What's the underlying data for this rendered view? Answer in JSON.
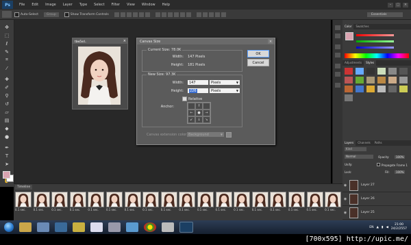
{
  "app": {
    "logo": "Ps",
    "menu": [
      "File",
      "Edit",
      "Image",
      "Layer",
      "Type",
      "Select",
      "Filter",
      "View",
      "Window",
      "Help"
    ]
  },
  "options_bar": {
    "auto_select_label": "Auto-Select",
    "auto_select_target": "Group",
    "show_transform_label": "Show Transform Controls",
    "workspace": "Essentials"
  },
  "document": {
    "title": "tbw5xd.."
  },
  "dialog": {
    "title": "Canvas Size",
    "current_size_label": "Current Size: 78.0K",
    "current_width_label": "Width:",
    "current_width_value": "147 Pixels",
    "current_height_label": "Height:",
    "current_height_value": "181 Pixels",
    "new_size_label": "New Size: 97.3K",
    "width_label": "Width:",
    "width_value": "147",
    "width_unit": "Pixels",
    "height_label": "Height:",
    "height_value": "226",
    "height_unit": "Pixels",
    "relative_label": "Relative",
    "anchor_label": "Anchor:",
    "extension_label": "Canvas extension color:",
    "extension_value": "Background",
    "ok_label": "OK",
    "cancel_label": "Cancel"
  },
  "right_panel": {
    "color_tabs": [
      "Color",
      "Swatches"
    ],
    "adj_tabs": [
      "Adjustments",
      "Styles"
    ],
    "layers_tabs": [
      "Layers",
      "Channels",
      "Paths"
    ],
    "kind_label": "Kind",
    "blend_mode": "Normal",
    "opacity_label": "Opacity:",
    "opacity_value": "100%",
    "unify_label": "Unify:",
    "propagate_label": "Propagate Frame 1",
    "lock_label": "Lock:",
    "fill_label": "Fill:",
    "fill_value": "100%",
    "layers": [
      "Layer 27",
      "Layer 26",
      "Layer 25"
    ]
  },
  "timeline": {
    "title": "Timeline",
    "frame_delay": "0.1 sec.",
    "frame_count": 18
  },
  "taskbar": {
    "lang": "EN",
    "time": "21:00",
    "date": "24/2/2557"
  },
  "watermark": "[700x595] http://upic.me/",
  "colors": {
    "accent": "#3a6ed0",
    "menubar": "#2b2b2b",
    "panel": "#3b3b3b",
    "workspace": "#282828"
  }
}
